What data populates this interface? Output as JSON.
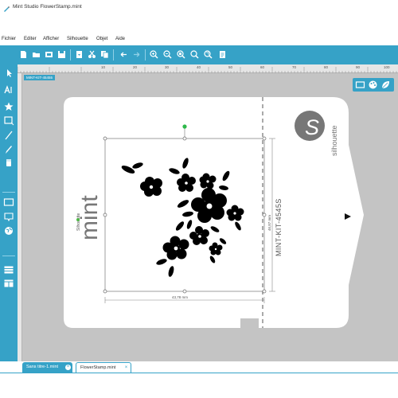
{
  "window": {
    "title": "Mint Studio FlowerStamp.mint"
  },
  "menu": {
    "items": [
      "Fichier",
      "Editer",
      "Afficher",
      "Silhouette",
      "Objet",
      "Aide"
    ]
  },
  "toolbar": {
    "buttons": [
      "new-icon",
      "open-icon",
      "library-icon",
      "save-icon",
      "import-icon",
      "cut-icon",
      "copy-icon",
      "paste-icon",
      "undo-icon",
      "redo-icon",
      "zoom-in-icon",
      "zoom-out-icon",
      "zoom-fit-icon",
      "zoom-selection-icon",
      "zoom-page-icon"
    ]
  },
  "left_tools": [
    "pointer-icon",
    "text-tool-icon",
    "star-tool-icon",
    "rectangle-tool-icon",
    "line-tool-icon",
    "pen-tool-icon",
    "eraser-tool-icon",
    "design-view-icon",
    "store-icon",
    "globe-icon",
    "layers-icon",
    "panels-icon"
  ],
  "ruler": {
    "marks": [
      "10",
      "20",
      "30",
      "40",
      "50",
      "60",
      "70",
      "80",
      "90",
      "100"
    ],
    "zoom_label": "MINT-KIT-45455"
  },
  "stamp": {
    "brand_small": "Silhouette",
    "brand": "mint",
    "code": "MINT-KIT-4545S",
    "logo_letter": "S",
    "logo_text": "silhouette"
  },
  "selection": {
    "width_label": "43,78 mm",
    "height_label": "46,87 mm"
  },
  "tabs": {
    "inactive": "Sans titre-1.mint",
    "active": "FlowerStamp.mint"
  },
  "colors": {
    "accent": "#36a2c7",
    "canvas": "#c4c4c4",
    "stamp": "#ffffff",
    "artwork": "#000000",
    "handle_rotate": "#2db84a"
  }
}
